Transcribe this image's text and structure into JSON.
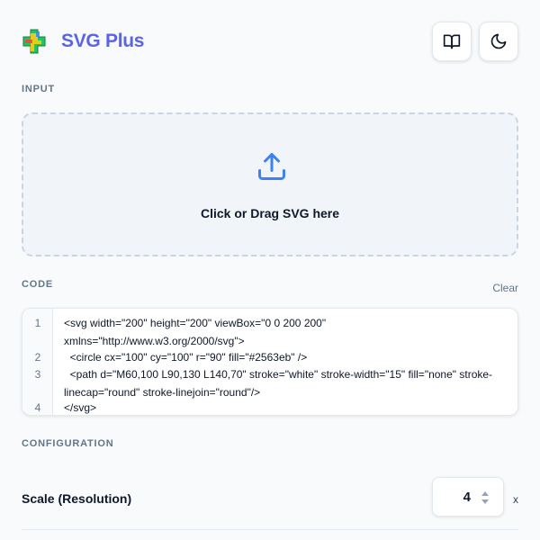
{
  "app": {
    "title": "SVG Plus",
    "accent_color": "#5b63e6",
    "logo_icon": "puzzle-cross-logo"
  },
  "header": {
    "docs_icon": "book-open-icon",
    "theme_icon": "moon-icon"
  },
  "input": {
    "section_label": "INPUT",
    "dropzone_text": "Click or Drag SVG here",
    "upload_icon": "upload-icon"
  },
  "code": {
    "section_label": "CODE",
    "clear_label": "Clear",
    "lines": [
      {
        "number": "1",
        "text": "<svg width=\"200\" height=\"200\" viewBox=\"0 0 200 200\" xmlns=\"http://www.w3.org/2000/svg\">"
      },
      {
        "number": "2",
        "text": "  <circle cx=\"100\" cy=\"100\" r=\"90\" fill=\"#2563eb\" />"
      },
      {
        "number": "3",
        "text": "  <path d=\"M60,100 L90,130 L140,70\" stroke=\"white\" stroke-width=\"15\" fill=\"none\" stroke-linecap=\"round\" stroke-linejoin=\"round\"/>"
      },
      {
        "number": "4",
        "text": "</svg>"
      }
    ]
  },
  "configuration": {
    "section_label": "CONFIGURATION",
    "scale_label": "Scale (Resolution)",
    "scale_value": "4",
    "scale_unit": "x"
  }
}
